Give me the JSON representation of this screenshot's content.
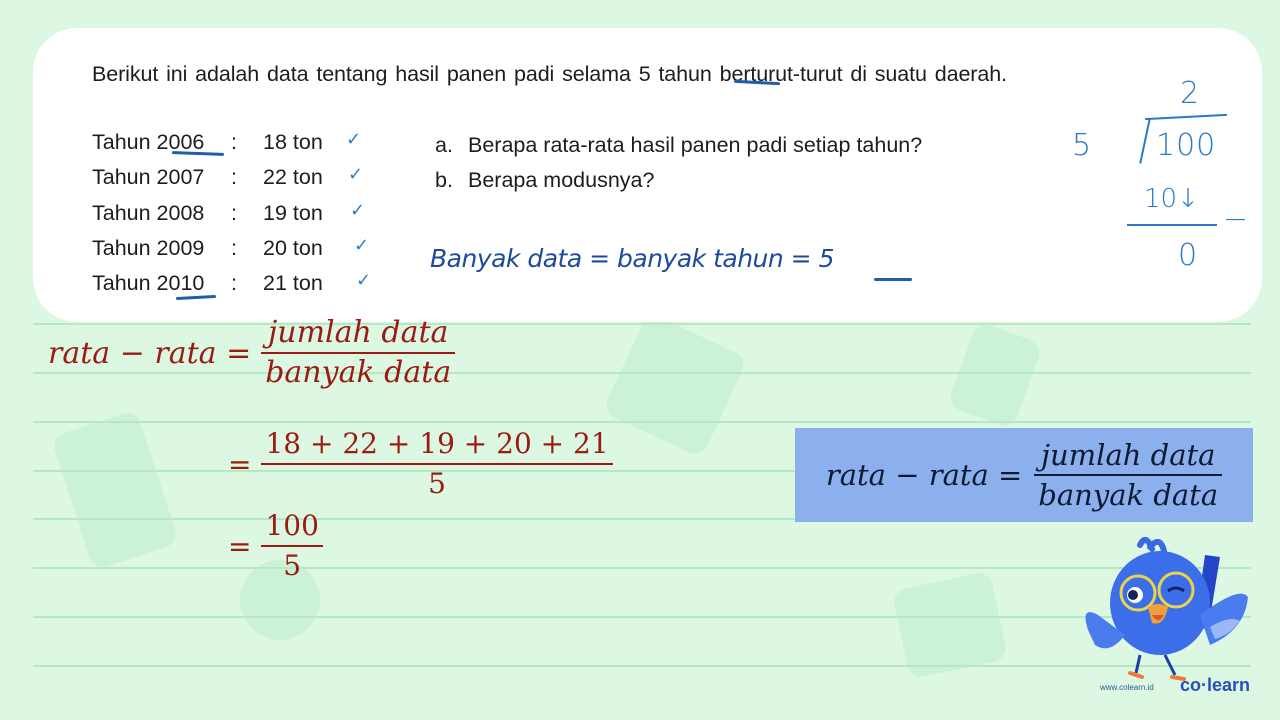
{
  "question": {
    "intro_before": "Berikut ini adalah data tentang hasil panen padi selama",
    "intro_highlight": " 5 ",
    "intro_after": "tahun berturut-turut di suatu daerah.",
    "data": [
      {
        "year": "Tahun 2006",
        "colon": ":",
        "value": "18 ton"
      },
      {
        "year": "Tahun 2007",
        "colon": ":",
        "value": "22 ton"
      },
      {
        "year": "Tahun 2008",
        "colon": ":",
        "value": "19 ton"
      },
      {
        "year": "Tahun 2009",
        "colon": ":",
        "value": "20 ton"
      },
      {
        "year": "Tahun 2010",
        "colon": ":",
        "value": "21 ton"
      }
    ],
    "check_mark": "✓",
    "check_mark_alt": "✓",
    "sub_questions": [
      {
        "label": "a.",
        "text": "Berapa rata-rata hasil panen padi setiap tahun?"
      },
      {
        "label": "b.",
        "text": "Berapa modusnya?"
      }
    ]
  },
  "handwriting": {
    "banyak_data": "Banyak data = banyak tahun = 5",
    "division": {
      "quotient": "2",
      "divisor": "5",
      "dividend": "100",
      "step": "10↓",
      "remainder": "0",
      "minus": "−"
    }
  },
  "solution": {
    "line1_lhs": "rata − rata =",
    "line1_num": "jumlah data",
    "line1_den": "banyak data",
    "line2_eq": "=",
    "line2_num": "18 + 22 + 19 + 20 + 21",
    "line2_den": "5",
    "line3_eq": "=",
    "line3_num": "100",
    "line3_den": "5"
  },
  "formula_box": {
    "lhs": "rata − rata =",
    "num": "jumlah data",
    "den": "banyak data"
  },
  "branding": {
    "site": "www.colearn.id",
    "logo": "co·learn"
  },
  "colors": {
    "background": "#dcf8e3",
    "card": "#ffffff",
    "math_text": "#9a1b12",
    "formula_box": "#8cb0ee",
    "handwriting": "#1f4fa0",
    "brand": "#2a4fb8"
  }
}
